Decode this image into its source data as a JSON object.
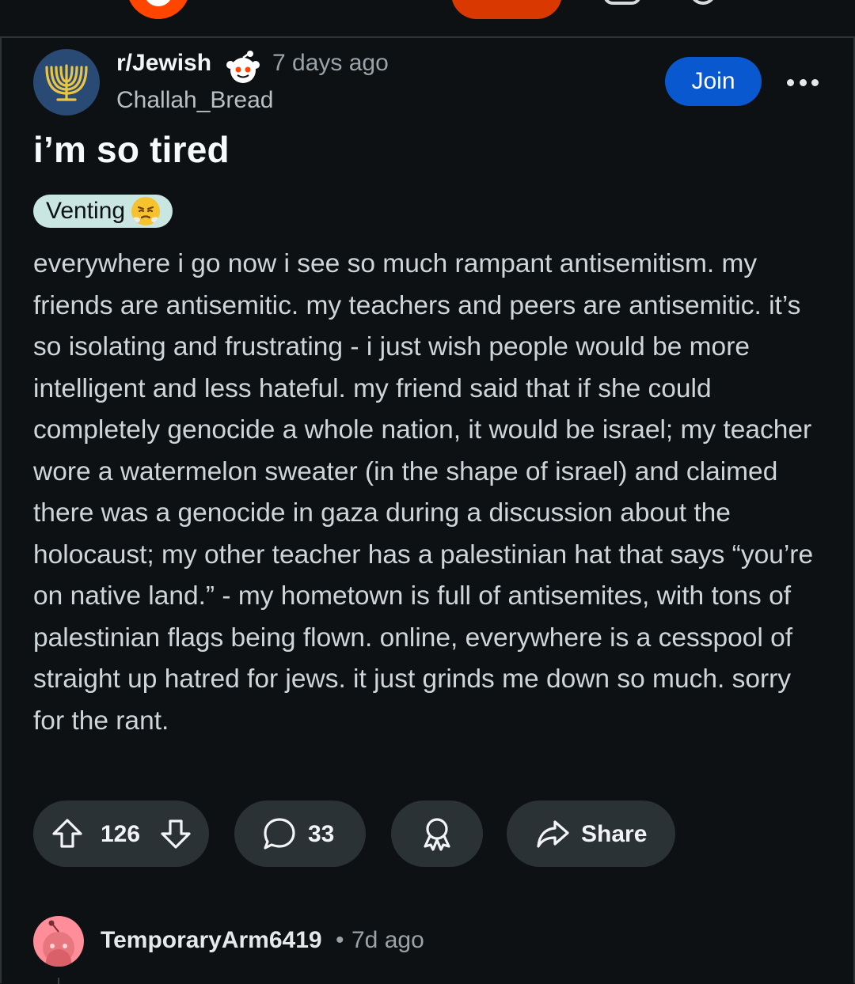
{
  "post": {
    "subreddit": "r/Jewish",
    "age": "7 days ago",
    "author": "Challah_Bread",
    "join_label": "Join",
    "title": "i’m so tired",
    "flair": "Venting",
    "body": "everywhere i go now i see so much rampant antisemitism. my friends are antisemitic. my teachers and peers are antisemitic. it’s so isolating and frustrating - i just wish people would be more intelligent and less hateful. my friend said that if she could completely genocide a whole nation, it would be israel; my teacher wore a watermelon sweater (in the shape of israel) and claimed there was a genocide in gaza during a discussion about the holocaust; my other teacher has a palestinian hat that says “you’re on native land.” - my hometown is full of antisemites, with tons of palestinian flags being flown. online, everywhere is a cesspool of straight up hatred for jews. it just grinds me down so much. sorry for the rant.",
    "votes": "126",
    "comments": "33",
    "share_label": "Share"
  },
  "comment": {
    "author": "TemporaryArm6419",
    "separator": "•",
    "age": "7d ago"
  },
  "colors": {
    "background": "#0e1113",
    "action_pill": "#2a3236",
    "join_button": "#0a58d0",
    "flair_background": "#cae6e3",
    "reddit_orange": "#ff4500"
  },
  "icons": {
    "subreddit_avatar": "menorah-icon",
    "flair_emoji": "steam-face-emoji",
    "upvote": "arrow-up-icon",
    "downvote": "arrow-down-icon",
    "comment": "speech-bubble-icon",
    "award": "award-ribbon-icon",
    "share": "share-arrow-icon",
    "more": "more-horizontal-icon"
  }
}
